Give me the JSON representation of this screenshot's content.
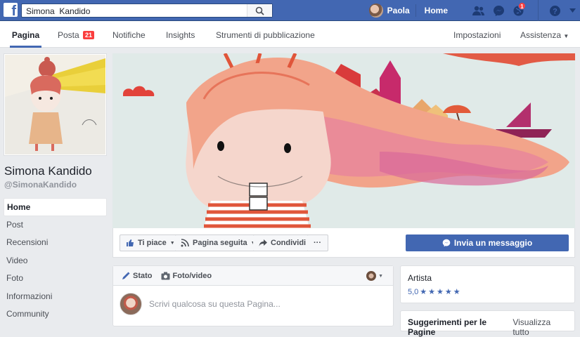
{
  "topbar": {
    "search_value": "Simona  Kandido",
    "user_name": "Paola",
    "home_label": "Home",
    "notification_badge": "1",
    "brand_color": "#4267b2"
  },
  "tabs": [
    {
      "label": "Pagina"
    },
    {
      "label": "Posta",
      "count": "21"
    },
    {
      "label": "Notifiche"
    },
    {
      "label": "Insights"
    },
    {
      "label": "Strumenti di pubblicazione"
    },
    {
      "label": "Impostazioni"
    },
    {
      "label": "Assistenza"
    }
  ],
  "profile": {
    "name": "Simona Kandido",
    "handle": "@SimonaKandido"
  },
  "menu": [
    "Home",
    "Post",
    "Recensioni",
    "Video",
    "Foto",
    "Informazioni",
    "Community"
  ],
  "actions": {
    "like": "Ti piace",
    "follow": "Pagina seguita",
    "share": "Condividi",
    "more": "···",
    "message": "Invia un messaggio"
  },
  "composer": {
    "status": "Stato",
    "photo": "Foto/video",
    "placeholder": "Scrivi qualcosa su questa Pagina..."
  },
  "about": {
    "category": "Artista",
    "rating": "5,0",
    "rating_stars": 5
  },
  "suggestions": {
    "title": "Suggerimenti per le Pagine",
    "link": "Visualizza tutto"
  }
}
